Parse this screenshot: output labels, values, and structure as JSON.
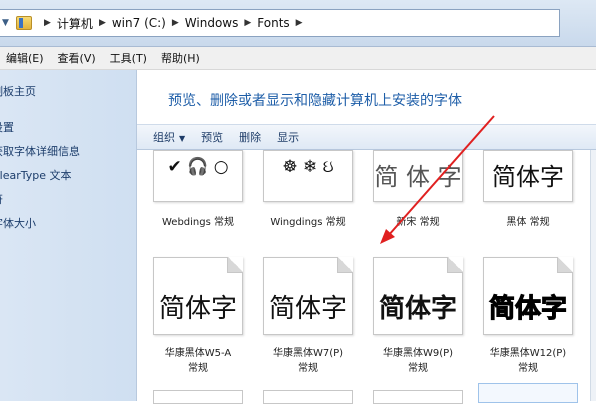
{
  "breadcrumb": [
    "计算机",
    "win7 (C:)",
    "Windows",
    "Fonts"
  ],
  "menu": [
    "编辑(E)",
    "查看(V)",
    "工具(T)",
    "帮助(H)"
  ],
  "leftnav": [
    "制板主页",
    "设置",
    "获取字体详细信息",
    "ClearType 文本",
    "符",
    "字体大小"
  ],
  "main_title": "预览、删除或者显示和隐藏计算机上安装的字体",
  "toolbar": {
    "organize": "组织",
    "preview": "预览",
    "delete": "删除",
    "show": "显示"
  },
  "fonts_row1": [
    {
      "sample": "✔ 🎧 ○",
      "caption": "Webdings 常规"
    },
    {
      "sample": "☸ ❄ ઇ",
      "caption": "Wingdings 常规"
    },
    {
      "sample": "简 体 字",
      "caption": "新宋 常规"
    },
    {
      "sample": "简体字",
      "caption": "黑体 常规"
    }
  ],
  "fonts_row2": [
    {
      "sample": "简体字",
      "caption_line1": "华康黑体W5-A",
      "caption_line2": "常规"
    },
    {
      "sample": "简体字",
      "caption_line1": "华康黑体W7(P)",
      "caption_line2": "常规"
    },
    {
      "sample": "简体字",
      "caption_line1": "华康黑体W9(P)",
      "caption_line2": "常规"
    },
    {
      "sample": "简体字",
      "caption_line1": "华康黑体W12(P)",
      "caption_line2": "常规"
    }
  ],
  "colors": {
    "accent_arrow": "#e02020",
    "title_blue": "#1e5ea8"
  }
}
